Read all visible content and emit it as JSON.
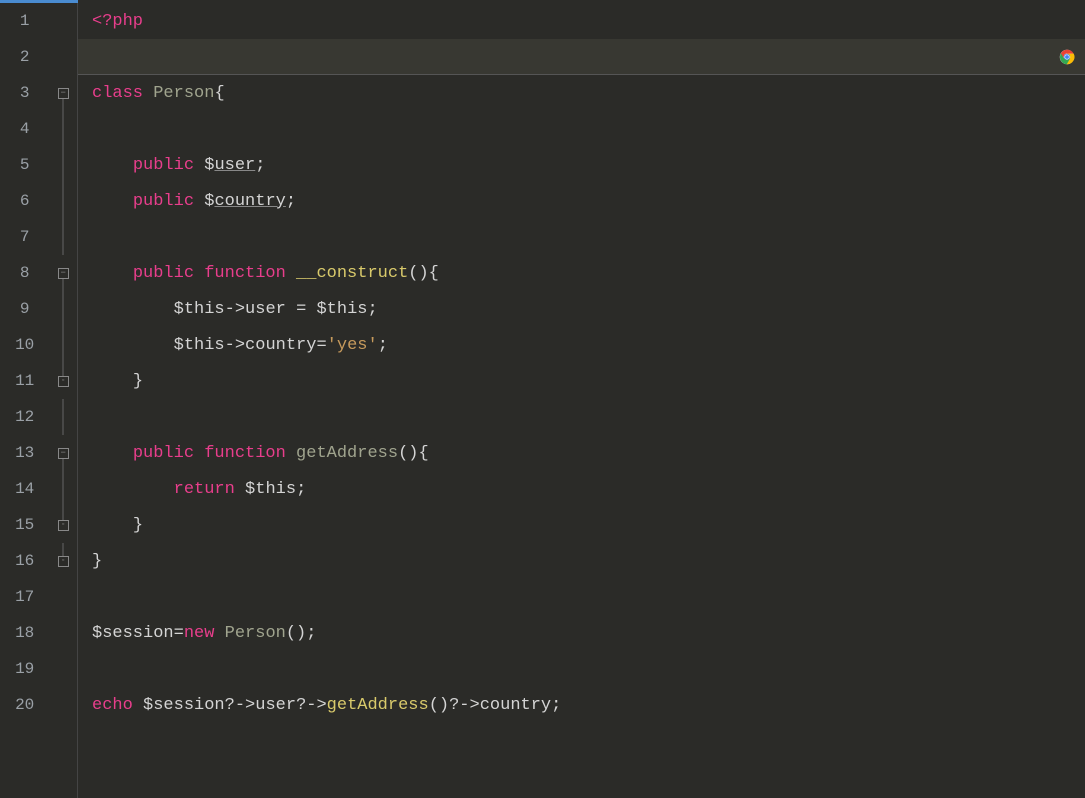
{
  "lines": [
    {
      "num": "1",
      "fold": "",
      "code": [
        {
          "cls": "t-tag",
          "t": "<?"
        },
        {
          "cls": "t-keyword",
          "t": "php"
        }
      ]
    },
    {
      "num": "2",
      "fold": "",
      "highlight": true,
      "code": []
    },
    {
      "num": "3",
      "fold": "open",
      "code": [
        {
          "cls": "t-class-kw",
          "t": "class "
        },
        {
          "cls": "t-class-name",
          "t": "Person"
        },
        {
          "cls": "t-punct",
          "t": "{"
        }
      ]
    },
    {
      "num": "4",
      "fold": "line",
      "code": []
    },
    {
      "num": "5",
      "fold": "line",
      "code": [
        {
          "cls": "",
          "t": "    "
        },
        {
          "cls": "t-keyword",
          "t": "public "
        },
        {
          "cls": "t-var",
          "t": "$"
        },
        {
          "cls": "t-prop-ul",
          "t": "user"
        },
        {
          "cls": "t-punct",
          "t": ";"
        }
      ]
    },
    {
      "num": "6",
      "fold": "line",
      "code": [
        {
          "cls": "",
          "t": "    "
        },
        {
          "cls": "t-keyword",
          "t": "public "
        },
        {
          "cls": "t-var",
          "t": "$"
        },
        {
          "cls": "t-prop-ul",
          "t": "country"
        },
        {
          "cls": "t-punct",
          "t": ";"
        }
      ]
    },
    {
      "num": "7",
      "fold": "line",
      "code": []
    },
    {
      "num": "8",
      "fold": "open",
      "code": [
        {
          "cls": "",
          "t": "    "
        },
        {
          "cls": "t-keyword",
          "t": "public function "
        },
        {
          "cls": "t-magic",
          "t": "__construct"
        },
        {
          "cls": "t-punct",
          "t": "(){"
        }
      ]
    },
    {
      "num": "9",
      "fold": "line",
      "code": [
        {
          "cls": "",
          "t": "        "
        },
        {
          "cls": "t-var",
          "t": "$this"
        },
        {
          "cls": "t-op",
          "t": "->"
        },
        {
          "cls": "t-prop",
          "t": "user "
        },
        {
          "cls": "t-op",
          "t": "= "
        },
        {
          "cls": "t-var",
          "t": "$this"
        },
        {
          "cls": "t-punct",
          "t": ";"
        }
      ]
    },
    {
      "num": "10",
      "fold": "line",
      "code": [
        {
          "cls": "",
          "t": "        "
        },
        {
          "cls": "t-var",
          "t": "$this"
        },
        {
          "cls": "t-op",
          "t": "->"
        },
        {
          "cls": "t-prop",
          "t": "country"
        },
        {
          "cls": "t-op",
          "t": "="
        },
        {
          "cls": "t-str",
          "t": "'yes'"
        },
        {
          "cls": "t-punct",
          "t": ";"
        }
      ]
    },
    {
      "num": "11",
      "fold": "close",
      "code": [
        {
          "cls": "",
          "t": "    "
        },
        {
          "cls": "t-punct",
          "t": "}"
        }
      ]
    },
    {
      "num": "12",
      "fold": "line",
      "code": []
    },
    {
      "num": "13",
      "fold": "open",
      "code": [
        {
          "cls": "",
          "t": "    "
        },
        {
          "cls": "t-keyword",
          "t": "public function "
        },
        {
          "cls": "t-func-name",
          "t": "getAddress"
        },
        {
          "cls": "t-punct",
          "t": "(){"
        }
      ]
    },
    {
      "num": "14",
      "fold": "line",
      "code": [
        {
          "cls": "",
          "t": "        "
        },
        {
          "cls": "t-return",
          "t": "return "
        },
        {
          "cls": "t-var",
          "t": "$this"
        },
        {
          "cls": "t-punct",
          "t": ";"
        }
      ]
    },
    {
      "num": "15",
      "fold": "close",
      "code": [
        {
          "cls": "",
          "t": "    "
        },
        {
          "cls": "t-punct",
          "t": "}"
        }
      ]
    },
    {
      "num": "16",
      "fold": "close",
      "code": [
        {
          "cls": "t-punct",
          "t": "}"
        }
      ]
    },
    {
      "num": "17",
      "fold": "",
      "code": []
    },
    {
      "num": "18",
      "fold": "",
      "code": [
        {
          "cls": "t-var",
          "t": "$session"
        },
        {
          "cls": "t-op",
          "t": "="
        },
        {
          "cls": "t-new",
          "t": "new "
        },
        {
          "cls": "t-class-name",
          "t": "Person"
        },
        {
          "cls": "t-punct",
          "t": "();"
        }
      ]
    },
    {
      "num": "19",
      "fold": "",
      "code": []
    },
    {
      "num": "20",
      "fold": "",
      "code": [
        {
          "cls": "t-echo",
          "t": "echo "
        },
        {
          "cls": "t-var",
          "t": "$session"
        },
        {
          "cls": "t-op",
          "t": "?->"
        },
        {
          "cls": "t-prop",
          "t": "user"
        },
        {
          "cls": "t-op",
          "t": "?->"
        },
        {
          "cls": "t-func-name-y",
          "t": "getAddress"
        },
        {
          "cls": "t-punct",
          "t": "()"
        },
        {
          "cls": "t-op",
          "t": "?->"
        },
        {
          "cls": "t-prop",
          "t": "country"
        },
        {
          "cls": "t-punct",
          "t": ";"
        }
      ]
    }
  ],
  "icons": {
    "fold_open": "▾",
    "fold_close": "▴"
  }
}
